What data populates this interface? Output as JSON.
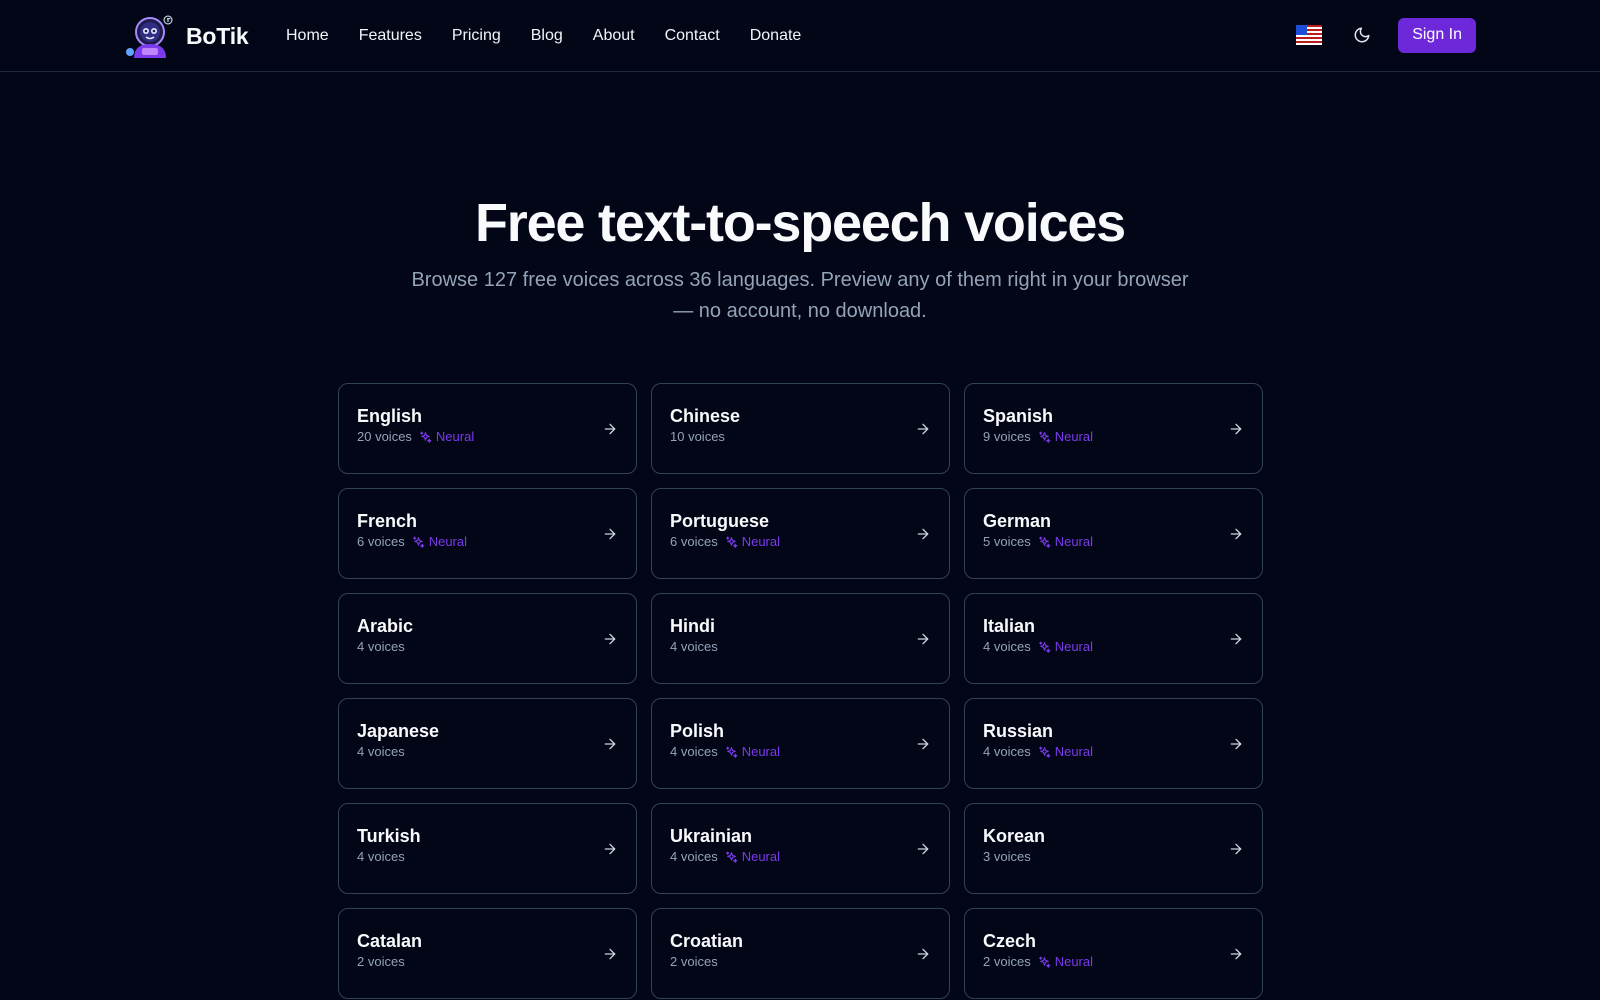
{
  "brand": {
    "name": "BoTik",
    "logo": "astronaut-robot-logo"
  },
  "nav": {
    "links": [
      "Home",
      "Features",
      "Pricing",
      "Blog",
      "About",
      "Contact",
      "Donate"
    ],
    "flag_icon": "us-flag-icon",
    "theme_icon": "moon-icon",
    "sign_in": "Sign In"
  },
  "hero": {
    "title": "Free text-to-speech voices",
    "subtitle": "Browse 127 free voices across 36 languages. Preview any of them right in your browser — no account, no download."
  },
  "neural_label": "Neural",
  "languages": [
    {
      "name": "English",
      "voices": "20 voices",
      "neural": true
    },
    {
      "name": "Chinese",
      "voices": "10 voices",
      "neural": false
    },
    {
      "name": "Spanish",
      "voices": "9 voices",
      "neural": true
    },
    {
      "name": "French",
      "voices": "6 voices",
      "neural": true
    },
    {
      "name": "Portuguese",
      "voices": "6 voices",
      "neural": true
    },
    {
      "name": "German",
      "voices": "5 voices",
      "neural": true
    },
    {
      "name": "Arabic",
      "voices": "4 voices",
      "neural": false
    },
    {
      "name": "Hindi",
      "voices": "4 voices",
      "neural": false
    },
    {
      "name": "Italian",
      "voices": "4 voices",
      "neural": true
    },
    {
      "name": "Japanese",
      "voices": "4 voices",
      "neural": false
    },
    {
      "name": "Polish",
      "voices": "4 voices",
      "neural": true
    },
    {
      "name": "Russian",
      "voices": "4 voices",
      "neural": true
    },
    {
      "name": "Turkish",
      "voices": "4 voices",
      "neural": false
    },
    {
      "name": "Ukrainian",
      "voices": "4 voices",
      "neural": true
    },
    {
      "name": "Korean",
      "voices": "3 voices",
      "neural": false
    },
    {
      "name": "Catalan",
      "voices": "2 voices",
      "neural": false
    },
    {
      "name": "Croatian",
      "voices": "2 voices",
      "neural": false
    },
    {
      "name": "Czech",
      "voices": "2 voices",
      "neural": true
    }
  ],
  "colors": {
    "background": "#020617",
    "accent": "#6d28d9",
    "neural": "#7c3aed",
    "card_border": "#334155",
    "muted_text": "#94a3b8"
  }
}
